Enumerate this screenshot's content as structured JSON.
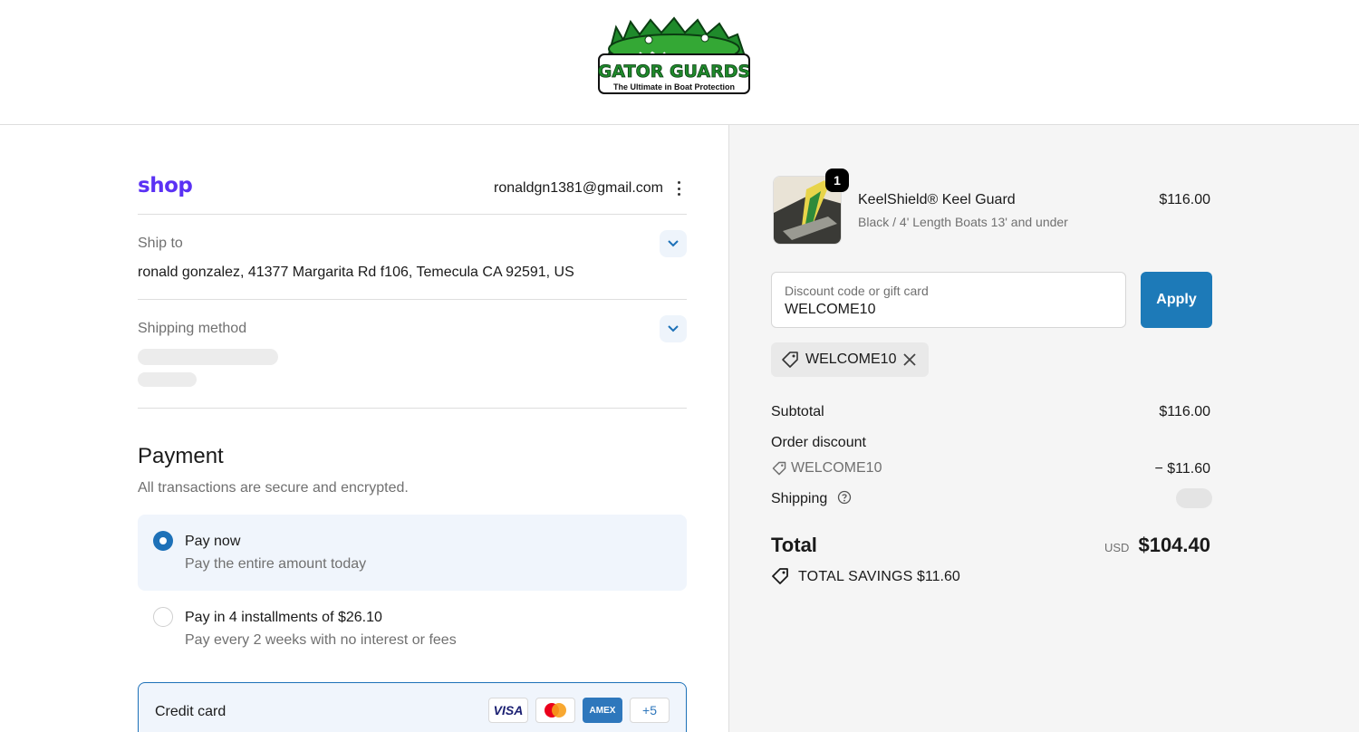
{
  "brand": {
    "logo_name": "GATOR GUARDS",
    "logo_tagline": "The Ultimate in Boat Protection"
  },
  "account": {
    "shop_logo": "shop",
    "email": "ronaldgn1381@gmail.com"
  },
  "shipping": {
    "ship_to_label": "Ship to",
    "address": "ronald gonzalez, 41377 Margarita Rd f106, Temecula CA 92591, US",
    "method_label": "Shipping method"
  },
  "payment": {
    "title": "Payment",
    "subtitle": "All transactions are secure and encrypted.",
    "options": [
      {
        "title": "Pay now",
        "subtitle": "Pay the entire amount today",
        "selected": true
      },
      {
        "title": "Pay in 4 installments of $26.10",
        "subtitle": "Pay every 2 weeks with no interest or fees",
        "selected": false
      }
    ],
    "credit_card_label": "Credit card",
    "cards": {
      "visa": "VISA",
      "amex": "AMEX",
      "more": "+5"
    }
  },
  "order": {
    "item": {
      "quantity": "1",
      "name": "KeelShield® Keel Guard",
      "variant": "Black / 4' Length Boats 13' and under",
      "price": "$116.00"
    },
    "discount": {
      "placeholder": "Discount code or gift card",
      "value": "WELCOME10",
      "apply_label": "Apply",
      "applied_code": "WELCOME10"
    },
    "summary": {
      "subtotal_label": "Subtotal",
      "subtotal": "$116.00",
      "order_discount_label": "Order discount",
      "discount_code": "WELCOME10",
      "discount_amount": "− $11.60",
      "shipping_label": "Shipping",
      "total_label": "Total",
      "currency": "USD",
      "total": "$104.40",
      "savings_label": "TOTAL SAVINGS",
      "savings_amount": "$11.60"
    }
  },
  "colors": {
    "accent": "#1d71b8",
    "shop_purple": "#5a31f4",
    "selected_bg": "#f0f5fc"
  }
}
